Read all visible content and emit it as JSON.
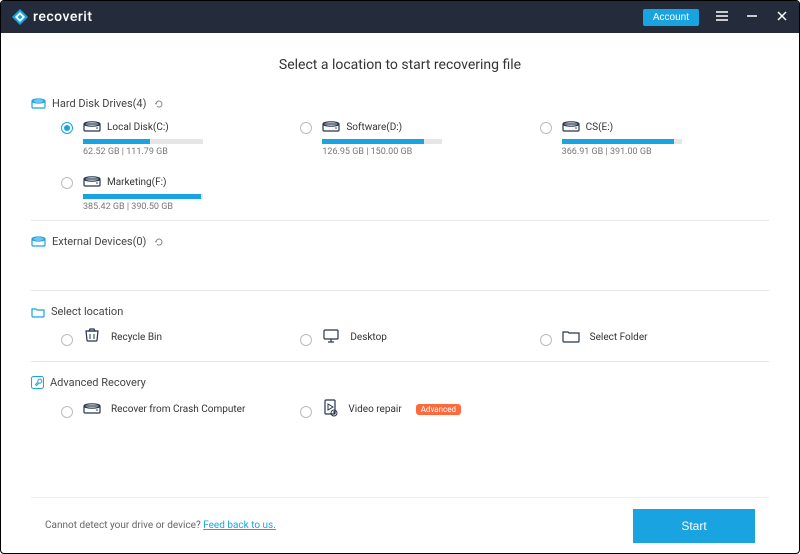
{
  "app": {
    "name": "recoverit"
  },
  "titlebar": {
    "account_label": "Account"
  },
  "page_title": "Select a location to start recovering file",
  "sections": {
    "hard_disk": {
      "label": "Hard Disk Drives(4)"
    },
    "external": {
      "label": "External Devices(0)"
    },
    "select_location": {
      "label": "Select location"
    },
    "advanced": {
      "label": "Advanced Recovery"
    }
  },
  "drives": [
    {
      "name": "Local Disk(C:)",
      "used": 62.52,
      "total": 111.79,
      "unit": "GB",
      "selected": true
    },
    {
      "name": "Software(D:)",
      "used": 126.95,
      "total": 150.0,
      "unit": "GB",
      "selected": false
    },
    {
      "name": "CS(E:)",
      "used": 366.91,
      "total": 391.0,
      "unit": "GB",
      "selected": false
    },
    {
      "name": "Marketing(F:)",
      "used": 385.42,
      "total": 390.5,
      "unit": "GB",
      "selected": false
    }
  ],
  "locations": [
    {
      "name": "Recycle Bin"
    },
    {
      "name": "Desktop"
    },
    {
      "name": "Select Folder"
    }
  ],
  "advanced": [
    {
      "name": "Recover from Crash Computer",
      "badge": null
    },
    {
      "name": "Video repair",
      "badge": "Advanced"
    }
  ],
  "footer": {
    "text": "Cannot detect your drive or device? ",
    "link": "Feed back to us.",
    "start": "Start"
  },
  "colors": {
    "accent": "#19a4e1",
    "header": "#242c3c",
    "badge": "#ff6a3d"
  }
}
